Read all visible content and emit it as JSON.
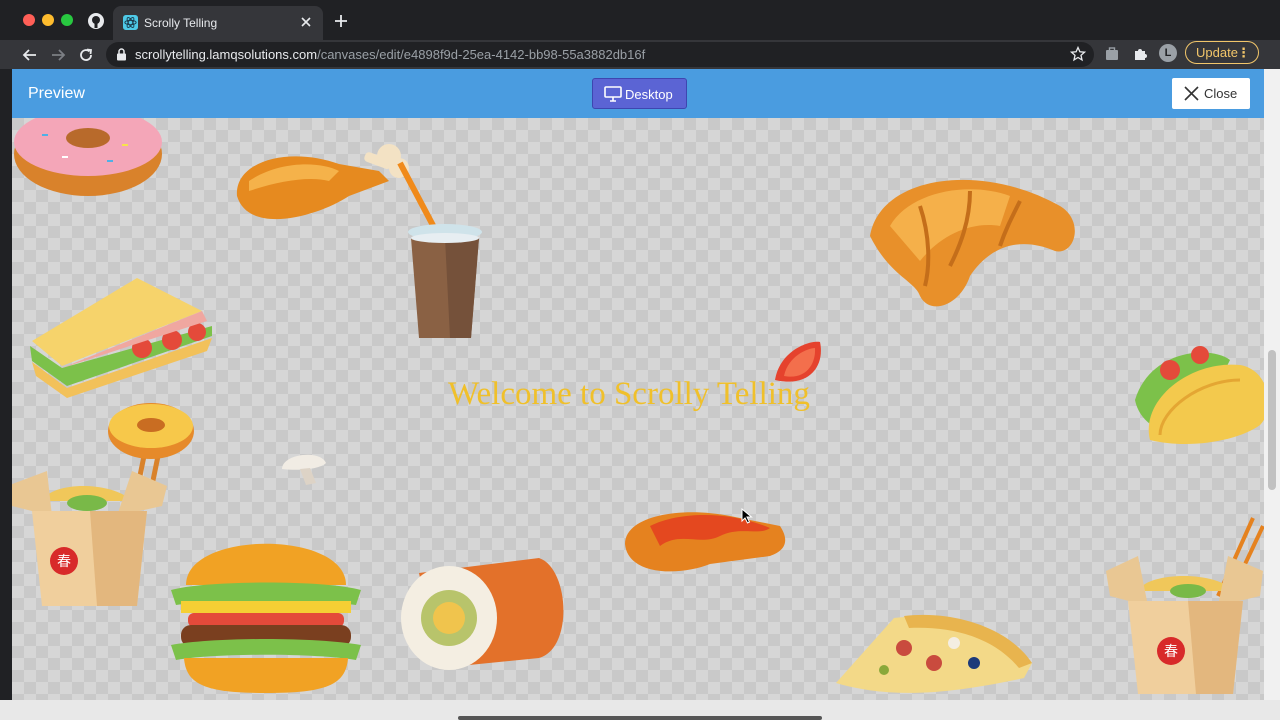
{
  "browser": {
    "tab_title": "Scrolly Telling",
    "url_host": "scrollytelling.lamqsolutions.com",
    "url_path": "/canvases/edit/e4898f9d-25ea-4142-bb98-55a3882db16f",
    "profile_initial": "L",
    "update_label": "Update"
  },
  "app": {
    "preview_label": "Preview",
    "device_button_label": "Desktop",
    "close_button_label": "Close"
  },
  "canvas": {
    "welcome_text": "Welcome to Scrolly Telling",
    "stickers": [
      "donut-sticker",
      "chicken-leg-sticker",
      "drink-cup-sticker",
      "croissant-sticker",
      "sandwich-sticker",
      "tomato-slice-sticker",
      "taco-sticker",
      "small-donut-sticker",
      "mushroom-sticker",
      "noodle-box-sticker",
      "chicken-wing-sticker",
      "burger-sticker",
      "sushi-sticker",
      "pizza-slice-sticker",
      "noodle-box-right-sticker"
    ]
  },
  "colors": {
    "header_bg": "#4a9ce0",
    "desktop_btn_bg": "#5b64d4",
    "welcome_text": "#f0c02a",
    "update_accent": "#f2c66a"
  }
}
